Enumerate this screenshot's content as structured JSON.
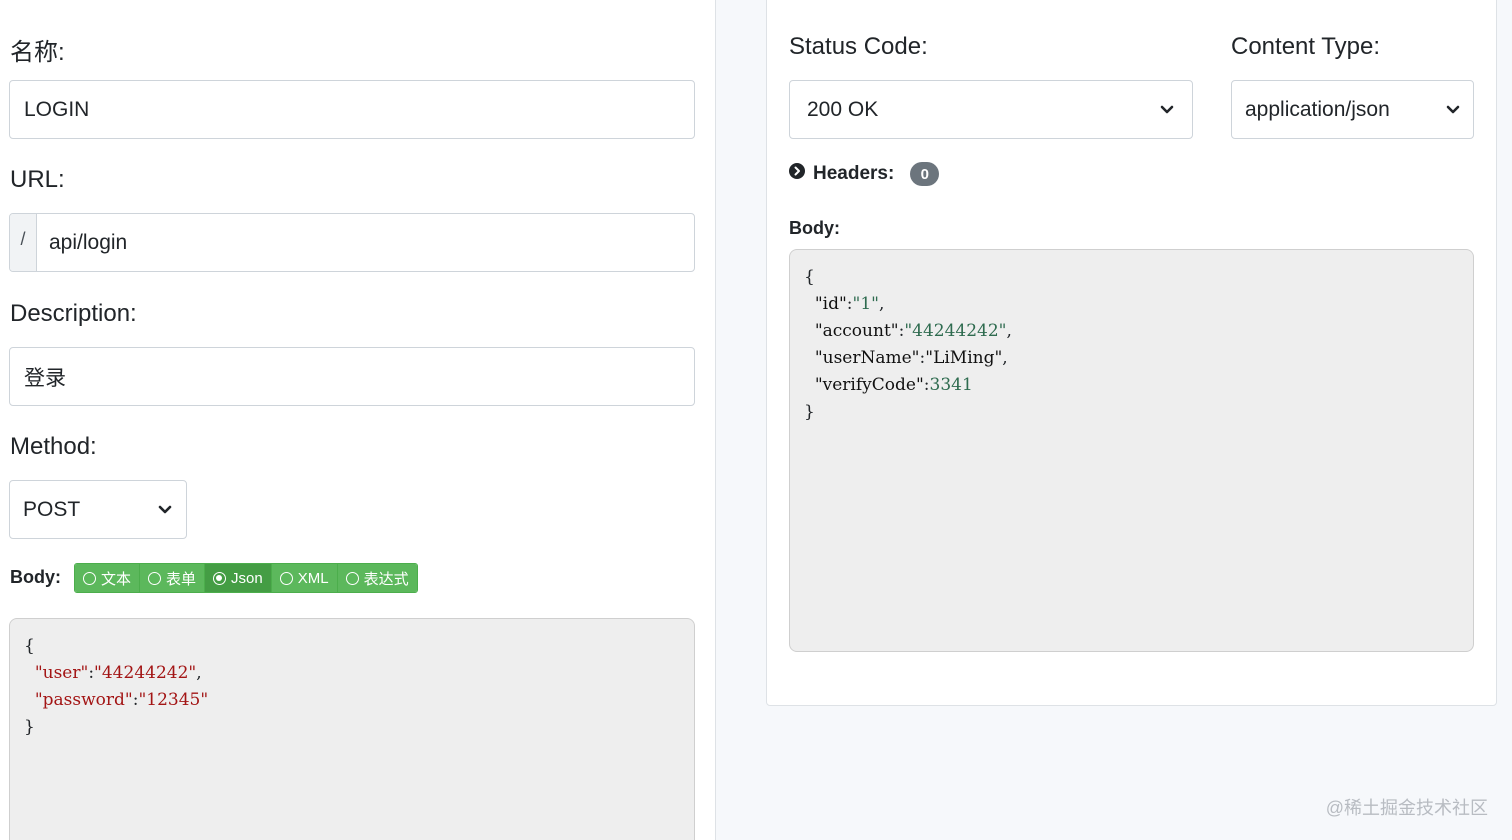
{
  "request": {
    "name_label": "名称:",
    "name_value": "LOGIN",
    "url_label": "URL:",
    "url_prefix": "/",
    "url_value": "api/login",
    "description_label": "Description:",
    "description_value": "登录",
    "method_label": "Method:",
    "method_value": "POST",
    "body_label": "Body:",
    "body_types": [
      {
        "label": "文本",
        "selected": false
      },
      {
        "label": "表单",
        "selected": false
      },
      {
        "label": "Json",
        "selected": true
      },
      {
        "label": "XML",
        "selected": false
      },
      {
        "label": "表达式",
        "selected": false
      }
    ],
    "body_json": {
      "open": "{",
      "lines": [
        {
          "key": "\"user\"",
          "sep": ":",
          "value": "\"44244242\"",
          "comma": ","
        },
        {
          "key": "\"password\"",
          "sep": ":",
          "value": "\"12345\"",
          "comma": ""
        }
      ],
      "close": "}"
    }
  },
  "response": {
    "status_label": "Status Code:",
    "status_value": "200 OK",
    "content_type_label": "Content Type:",
    "content_type_value": "application/json",
    "headers_label": "Headers:",
    "headers_count": "0",
    "body_label": "Body:",
    "body_json": {
      "open": "{",
      "lines": [
        {
          "key": "\"id\"",
          "sep": ":",
          "value": "\"1\"",
          "comma": ","
        },
        {
          "key": "\"account\"",
          "sep": ":",
          "value": "\"44244242\"",
          "comma": ","
        },
        {
          "key": "\"userName\"",
          "sep": ":",
          "value": "\"LiMing\"",
          "comma": ","
        },
        {
          "key": "\"verifyCode\"",
          "sep": ":",
          "value": "3341",
          "comma": ""
        }
      ],
      "close": "}"
    }
  },
  "watermark": "@稀土掘金技术社区",
  "colors": {
    "button_green": "#5cb85c",
    "button_green_active": "#449d44",
    "badge_gray": "#6c757d",
    "code_bg": "#eeeeee"
  }
}
